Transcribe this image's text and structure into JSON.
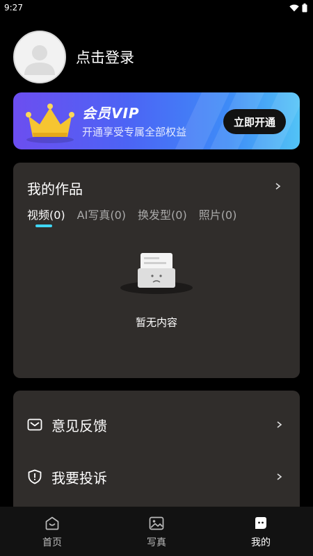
{
  "status_bar": {
    "time": "9:27"
  },
  "profile": {
    "login_text": "点击登录"
  },
  "vip": {
    "title": "会员VIP",
    "subtitle": "开通享受专属全部权益",
    "button_label": "立即开通",
    "colors": {
      "start": "#6c4ef0",
      "end": "#52c3f6",
      "crown": "#f6c531"
    }
  },
  "works": {
    "title": "我的作品",
    "tabs": [
      {
        "label": "视频(0)",
        "active": true
      },
      {
        "label": "AI写真(0)",
        "active": false
      },
      {
        "label": "换发型(0)",
        "active": false
      },
      {
        "label": "照片(0)",
        "active": false
      }
    ],
    "empty_text": "暂无内容",
    "accent": "#3fd6f4"
  },
  "menu": {
    "items": [
      {
        "label": "意见反馈",
        "icon": "mail-icon"
      },
      {
        "label": "我要投诉",
        "icon": "shield-alert-icon"
      }
    ]
  },
  "bottom_nav": {
    "items": [
      {
        "label": "首页",
        "icon": "home-smile-icon",
        "active": false
      },
      {
        "label": "写真",
        "icon": "image-icon",
        "active": false
      },
      {
        "label": "我的",
        "icon": "profile-face-icon",
        "active": true
      }
    ]
  }
}
